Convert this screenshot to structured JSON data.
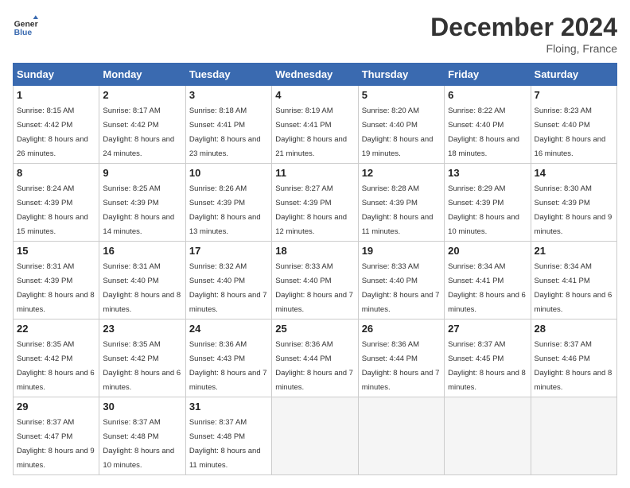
{
  "header": {
    "logo_line1": "General",
    "logo_line2": "Blue",
    "month_title": "December 2024",
    "location": "Floing, France"
  },
  "weekdays": [
    "Sunday",
    "Monday",
    "Tuesday",
    "Wednesday",
    "Thursday",
    "Friday",
    "Saturday"
  ],
  "weeks": [
    [
      {
        "day": "1",
        "sunrise": "Sunrise: 8:15 AM",
        "sunset": "Sunset: 4:42 PM",
        "daylight": "Daylight: 8 hours and 26 minutes."
      },
      {
        "day": "2",
        "sunrise": "Sunrise: 8:17 AM",
        "sunset": "Sunset: 4:42 PM",
        "daylight": "Daylight: 8 hours and 24 minutes."
      },
      {
        "day": "3",
        "sunrise": "Sunrise: 8:18 AM",
        "sunset": "Sunset: 4:41 PM",
        "daylight": "Daylight: 8 hours and 23 minutes."
      },
      {
        "day": "4",
        "sunrise": "Sunrise: 8:19 AM",
        "sunset": "Sunset: 4:41 PM",
        "daylight": "Daylight: 8 hours and 21 minutes."
      },
      {
        "day": "5",
        "sunrise": "Sunrise: 8:20 AM",
        "sunset": "Sunset: 4:40 PM",
        "daylight": "Daylight: 8 hours and 19 minutes."
      },
      {
        "day": "6",
        "sunrise": "Sunrise: 8:22 AM",
        "sunset": "Sunset: 4:40 PM",
        "daylight": "Daylight: 8 hours and 18 minutes."
      },
      {
        "day": "7",
        "sunrise": "Sunrise: 8:23 AM",
        "sunset": "Sunset: 4:40 PM",
        "daylight": "Daylight: 8 hours and 16 minutes."
      }
    ],
    [
      {
        "day": "8",
        "sunrise": "Sunrise: 8:24 AM",
        "sunset": "Sunset: 4:39 PM",
        "daylight": "Daylight: 8 hours and 15 minutes."
      },
      {
        "day": "9",
        "sunrise": "Sunrise: 8:25 AM",
        "sunset": "Sunset: 4:39 PM",
        "daylight": "Daylight: 8 hours and 14 minutes."
      },
      {
        "day": "10",
        "sunrise": "Sunrise: 8:26 AM",
        "sunset": "Sunset: 4:39 PM",
        "daylight": "Daylight: 8 hours and 13 minutes."
      },
      {
        "day": "11",
        "sunrise": "Sunrise: 8:27 AM",
        "sunset": "Sunset: 4:39 PM",
        "daylight": "Daylight: 8 hours and 12 minutes."
      },
      {
        "day": "12",
        "sunrise": "Sunrise: 8:28 AM",
        "sunset": "Sunset: 4:39 PM",
        "daylight": "Daylight: 8 hours and 11 minutes."
      },
      {
        "day": "13",
        "sunrise": "Sunrise: 8:29 AM",
        "sunset": "Sunset: 4:39 PM",
        "daylight": "Daylight: 8 hours and 10 minutes."
      },
      {
        "day": "14",
        "sunrise": "Sunrise: 8:30 AM",
        "sunset": "Sunset: 4:39 PM",
        "daylight": "Daylight: 8 hours and 9 minutes."
      }
    ],
    [
      {
        "day": "15",
        "sunrise": "Sunrise: 8:31 AM",
        "sunset": "Sunset: 4:39 PM",
        "daylight": "Daylight: 8 hours and 8 minutes."
      },
      {
        "day": "16",
        "sunrise": "Sunrise: 8:31 AM",
        "sunset": "Sunset: 4:40 PM",
        "daylight": "Daylight: 8 hours and 8 minutes."
      },
      {
        "day": "17",
        "sunrise": "Sunrise: 8:32 AM",
        "sunset": "Sunset: 4:40 PM",
        "daylight": "Daylight: 8 hours and 7 minutes."
      },
      {
        "day": "18",
        "sunrise": "Sunrise: 8:33 AM",
        "sunset": "Sunset: 4:40 PM",
        "daylight": "Daylight: 8 hours and 7 minutes."
      },
      {
        "day": "19",
        "sunrise": "Sunrise: 8:33 AM",
        "sunset": "Sunset: 4:40 PM",
        "daylight": "Daylight: 8 hours and 7 minutes."
      },
      {
        "day": "20",
        "sunrise": "Sunrise: 8:34 AM",
        "sunset": "Sunset: 4:41 PM",
        "daylight": "Daylight: 8 hours and 6 minutes."
      },
      {
        "day": "21",
        "sunrise": "Sunrise: 8:34 AM",
        "sunset": "Sunset: 4:41 PM",
        "daylight": "Daylight: 8 hours and 6 minutes."
      }
    ],
    [
      {
        "day": "22",
        "sunrise": "Sunrise: 8:35 AM",
        "sunset": "Sunset: 4:42 PM",
        "daylight": "Daylight: 8 hours and 6 minutes."
      },
      {
        "day": "23",
        "sunrise": "Sunrise: 8:35 AM",
        "sunset": "Sunset: 4:42 PM",
        "daylight": "Daylight: 8 hours and 6 minutes."
      },
      {
        "day": "24",
        "sunrise": "Sunrise: 8:36 AM",
        "sunset": "Sunset: 4:43 PM",
        "daylight": "Daylight: 8 hours and 7 minutes."
      },
      {
        "day": "25",
        "sunrise": "Sunrise: 8:36 AM",
        "sunset": "Sunset: 4:44 PM",
        "daylight": "Daylight: 8 hours and 7 minutes."
      },
      {
        "day": "26",
        "sunrise": "Sunrise: 8:36 AM",
        "sunset": "Sunset: 4:44 PM",
        "daylight": "Daylight: 8 hours and 7 minutes."
      },
      {
        "day": "27",
        "sunrise": "Sunrise: 8:37 AM",
        "sunset": "Sunset: 4:45 PM",
        "daylight": "Daylight: 8 hours and 8 minutes."
      },
      {
        "day": "28",
        "sunrise": "Sunrise: 8:37 AM",
        "sunset": "Sunset: 4:46 PM",
        "daylight": "Daylight: 8 hours and 8 minutes."
      }
    ],
    [
      {
        "day": "29",
        "sunrise": "Sunrise: 8:37 AM",
        "sunset": "Sunset: 4:47 PM",
        "daylight": "Daylight: 8 hours and 9 minutes."
      },
      {
        "day": "30",
        "sunrise": "Sunrise: 8:37 AM",
        "sunset": "Sunset: 4:48 PM",
        "daylight": "Daylight: 8 hours and 10 minutes."
      },
      {
        "day": "31",
        "sunrise": "Sunrise: 8:37 AM",
        "sunset": "Sunset: 4:48 PM",
        "daylight": "Daylight: 8 hours and 11 minutes."
      },
      null,
      null,
      null,
      null
    ]
  ]
}
